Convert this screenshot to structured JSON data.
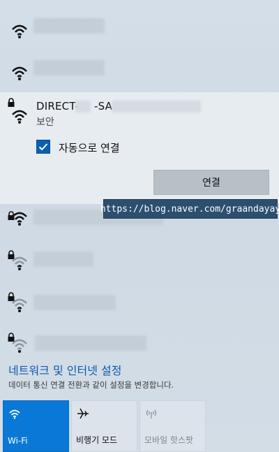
{
  "selected_network": {
    "ssid_prefix": "DIRECT-",
    "ssid_mid": "-SA",
    "status": "보안",
    "auto_connect_label": "자동으로 연결",
    "auto_connect_checked": true,
    "connect_label": "연결"
  },
  "watermark": "https://blog.naver.com/graandayay",
  "settings": {
    "link": "네트워크 및 인터넷 설정",
    "description": "데이터 통신 연결 전환과 같이 설정을 변경합니다."
  },
  "quick_actions": [
    {
      "label": "Wi-Fi",
      "icon": "wifi-icon",
      "state": "active"
    },
    {
      "label": "비행기 모드",
      "icon": "airplane-icon",
      "state": "inactive"
    },
    {
      "label": "모바일 핫스팟",
      "icon": "hotspot-icon",
      "state": "disabled"
    }
  ],
  "colors": {
    "accent": "#0a78d7",
    "link": "#0b5cae"
  }
}
